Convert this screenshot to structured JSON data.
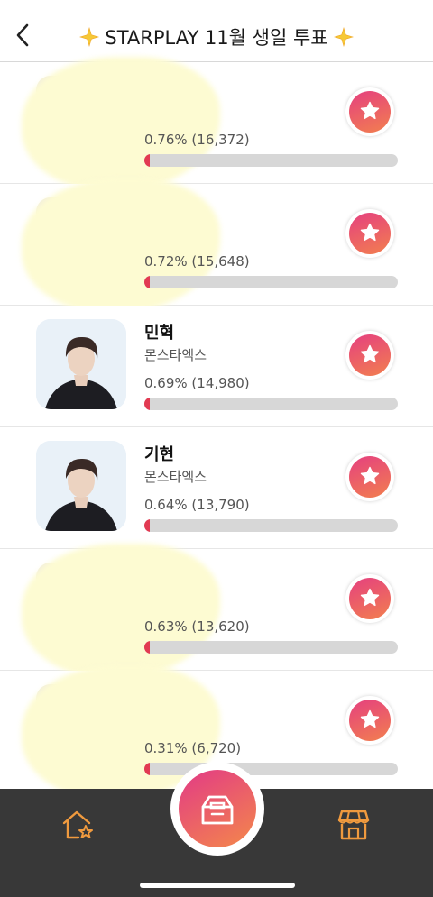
{
  "header": {
    "title": "STARPLAY 11월 생일 투표"
  },
  "rows": [
    {
      "name": "",
      "group": "",
      "stats": "0.76% (16,372)",
      "percent": 0.76,
      "obscured": true
    },
    {
      "name": "",
      "group": "",
      "stats": "0.72% (15,648)",
      "percent": 0.72,
      "obscured": true
    },
    {
      "name": "민혁",
      "group": "몬스타엑스",
      "stats": "0.69% (14,980)",
      "percent": 0.69,
      "obscured": false
    },
    {
      "name": "기현",
      "group": "몬스타엑스",
      "stats": "0.64% (13,790)",
      "percent": 0.64,
      "obscured": false
    },
    {
      "name": "",
      "group": "",
      "stats": "0.63% (13,620)",
      "percent": 0.63,
      "obscured": true
    },
    {
      "name": "",
      "group": "",
      "stats": "0.31% (6,720)",
      "percent": 0.31,
      "obscured": true
    }
  ],
  "colors": {
    "accent_start": "#e5407f",
    "accent_end": "#f27f4f",
    "bar_fill": "#e23a52",
    "bar_track": "#d7d7d7",
    "nav_bg": "#383838",
    "nav_icon": "#f09a3e"
  },
  "icons": {
    "back": "chevron-left-icon",
    "vote": "star-icon",
    "nav_home": "home-star-icon",
    "nav_center": "ballot-box-icon",
    "nav_shop": "store-icon"
  }
}
